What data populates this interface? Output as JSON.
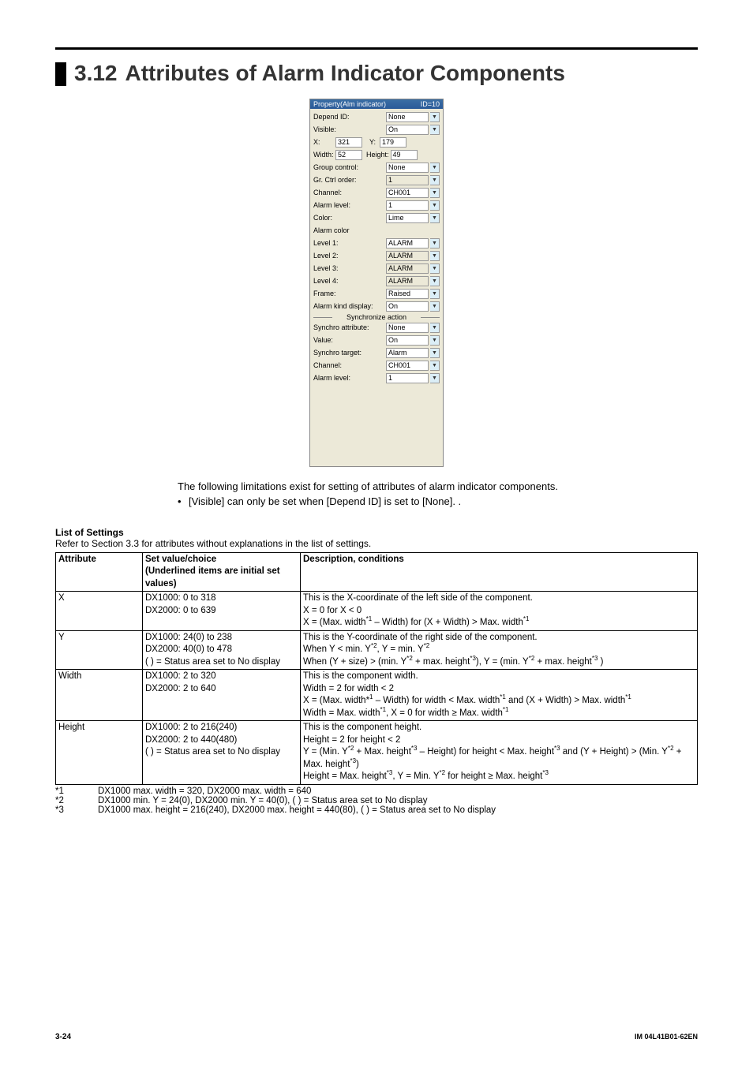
{
  "title": {
    "num": "3.12",
    "text": "Attributes of Alarm Indicator Components"
  },
  "panel": {
    "header_left": "Property(Alm indicator)",
    "header_right": "ID=10",
    "rows": {
      "depend_id": {
        "label": "Depend ID:",
        "value": "None"
      },
      "visible": {
        "label": "Visible:",
        "value": "On"
      },
      "x": {
        "label": "X:",
        "value": "321"
      },
      "y": {
        "label": "Y:",
        "value": "179"
      },
      "width": {
        "label": "Width:",
        "value": "52"
      },
      "height": {
        "label": "Height:",
        "value": "49"
      },
      "group_control": {
        "label": "Group control:",
        "value": "None"
      },
      "gr_ctrl_order": {
        "label": "Gr. Ctrl order:",
        "value": "1"
      },
      "channel": {
        "label": "Channel:",
        "value": "CH001"
      },
      "alarm_level": {
        "label": "Alarm level:",
        "value": "1"
      },
      "color": {
        "label": "Color:",
        "value": "Lime"
      },
      "alarm_color_header": "Alarm color",
      "level1": {
        "label": "Level 1:",
        "value": "ALARM"
      },
      "level2": {
        "label": "Level 2:",
        "value": "ALARM"
      },
      "level3": {
        "label": "Level 3:",
        "value": "ALARM"
      },
      "level4": {
        "label": "Level 4:",
        "value": "ALARM"
      },
      "frame": {
        "label": "Frame:",
        "value": "Raised"
      },
      "alarm_kind_display": {
        "label": "Alarm kind display:",
        "value": "On"
      },
      "sync_header": "Synchronize action",
      "synchro_attribute": {
        "label": "Synchro attribute:",
        "value": "None"
      },
      "value": {
        "label": "Value:",
        "value": "On"
      },
      "synchro_target": {
        "label": "Synchro target:",
        "value": "Alarm"
      },
      "channel2": {
        "label": "Channel:",
        "value": "CH001"
      },
      "alarm_level2": {
        "label": "Alarm level:",
        "value": "1"
      }
    }
  },
  "body": {
    "intro": "The following limitations exist for setting of attributes of alarm indicator components.",
    "bullet1": "[Visible] can only be set when [Depend ID] is set to [None]. ."
  },
  "list": {
    "heading": "List of Settings",
    "sub": "Refer to Section 3.3 for attributes without explanations in the list of settings.",
    "header": {
      "attr": "Attribute",
      "set_line1": "Set value/choice",
      "set_line2": "(Underlined items are initial set values)",
      "desc": "Description, conditions"
    },
    "rows": {
      "x": {
        "attr": "X",
        "set_l1": "DX1000: 0 to 318",
        "set_l2": "DX2000: 0 to 639",
        "desc_l1": "This is the X-coordinate of the left side of the component.",
        "desc_l2": "X = 0 for X < 0",
        "desc_l3_a": "X = (Max. width",
        "desc_l3_b": " – Width) for (X + Width) > Max. width"
      },
      "y": {
        "attr": "Y",
        "set_l1": "DX1000: 24(0) to 238",
        "set_l2": "DX2000: 40(0) to 478",
        "set_l3": "(   ) = Status area set to No display",
        "desc_l1": "This is the Y-coordinate of the right side of the component.",
        "desc_l2_a": "When Y < min. Y",
        "desc_l2_b": ", Y = min. Y",
        "desc_l3_a": "When (Y + size) > (min. Y",
        "desc_l3_b": " + max. height",
        "desc_l3_c": "), Y = (min. Y",
        "desc_l3_d": " + max. height",
        "desc_l3_e": " )"
      },
      "width": {
        "attr": "Width",
        "set_l1": "DX1000: 2 to 320",
        "set_l2": "DX2000: 2 to 640",
        "desc_l1": "This is the component width.",
        "desc_l2": "Width = 2 for width < 2",
        "desc_l3_a": "X = (Max. width*",
        "desc_l3_b": " – Width) for width < Max. width",
        "desc_l3_c": " and (X + Width) > Max. width",
        "desc_l4_a": "Width = Max. width",
        "desc_l4_b": ", X = 0 for width ≥ Max. width"
      },
      "height": {
        "attr": "Height",
        "set_l1": "DX1000: 2 to 216(240)",
        "set_l2": "DX2000: 2 to 440(480)",
        "set_l3": "(   ) = Status area set to No display",
        "desc_l1": "This is the component height.",
        "desc_l2": "Height = 2 for height < 2",
        "desc_l3_a": "Y = (Min. Y",
        "desc_l3_b": " + Max. height",
        "desc_l3_c": " – Height) for height < Max. height",
        "desc_l3_d": " and (Y + Height) > (Min. Y",
        "desc_l3_e": " + Max. height",
        "desc_l3_f": ")",
        "desc_l4_a": "Height = Max. height",
        "desc_l4_b": ", Y = Min. Y",
        "desc_l4_c": " for height ≥ Max. height"
      }
    }
  },
  "footnotes": {
    "f1": {
      "key": "*1",
      "text": "DX1000 max. width = 320, DX2000 max. width = 640"
    },
    "f2": {
      "key": "*2",
      "text": "DX1000 min. Y = 24(0), DX2000 min. Y = 40(0), (   ) = Status area set to No display"
    },
    "f3": {
      "key": "*3",
      "text": "DX1000 max. height = 216(240), DX2000 max. height = 440(80), (   ) = Status area set to No display"
    }
  },
  "footer": {
    "left": "3-24",
    "right": "IM 04L41B01-62EN"
  }
}
